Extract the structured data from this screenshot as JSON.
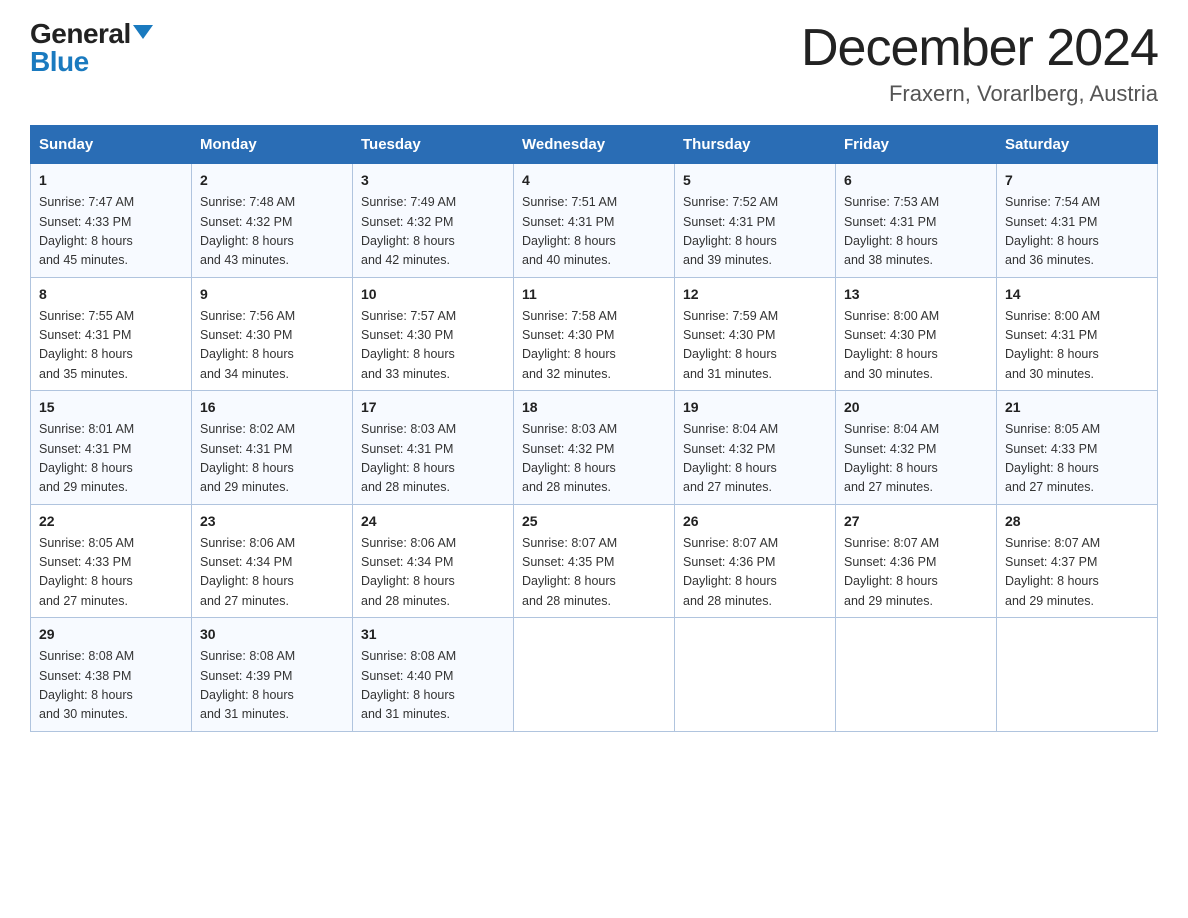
{
  "header": {
    "logo_general": "General",
    "logo_blue": "Blue",
    "month_title": "December 2024",
    "location": "Fraxern, Vorarlberg, Austria"
  },
  "days_of_week": [
    "Sunday",
    "Monday",
    "Tuesday",
    "Wednesday",
    "Thursday",
    "Friday",
    "Saturday"
  ],
  "weeks": [
    [
      {
        "day": "1",
        "sunrise": "7:47 AM",
        "sunset": "4:33 PM",
        "daylight": "8 hours and 45 minutes."
      },
      {
        "day": "2",
        "sunrise": "7:48 AM",
        "sunset": "4:32 PM",
        "daylight": "8 hours and 43 minutes."
      },
      {
        "day": "3",
        "sunrise": "7:49 AM",
        "sunset": "4:32 PM",
        "daylight": "8 hours and 42 minutes."
      },
      {
        "day": "4",
        "sunrise": "7:51 AM",
        "sunset": "4:31 PM",
        "daylight": "8 hours and 40 minutes."
      },
      {
        "day": "5",
        "sunrise": "7:52 AM",
        "sunset": "4:31 PM",
        "daylight": "8 hours and 39 minutes."
      },
      {
        "day": "6",
        "sunrise": "7:53 AM",
        "sunset": "4:31 PM",
        "daylight": "8 hours and 38 minutes."
      },
      {
        "day": "7",
        "sunrise": "7:54 AM",
        "sunset": "4:31 PM",
        "daylight": "8 hours and 36 minutes."
      }
    ],
    [
      {
        "day": "8",
        "sunrise": "7:55 AM",
        "sunset": "4:31 PM",
        "daylight": "8 hours and 35 minutes."
      },
      {
        "day": "9",
        "sunrise": "7:56 AM",
        "sunset": "4:30 PM",
        "daylight": "8 hours and 34 minutes."
      },
      {
        "day": "10",
        "sunrise": "7:57 AM",
        "sunset": "4:30 PM",
        "daylight": "8 hours and 33 minutes."
      },
      {
        "day": "11",
        "sunrise": "7:58 AM",
        "sunset": "4:30 PM",
        "daylight": "8 hours and 32 minutes."
      },
      {
        "day": "12",
        "sunrise": "7:59 AM",
        "sunset": "4:30 PM",
        "daylight": "8 hours and 31 minutes."
      },
      {
        "day": "13",
        "sunrise": "8:00 AM",
        "sunset": "4:30 PM",
        "daylight": "8 hours and 30 minutes."
      },
      {
        "day": "14",
        "sunrise": "8:00 AM",
        "sunset": "4:31 PM",
        "daylight": "8 hours and 30 minutes."
      }
    ],
    [
      {
        "day": "15",
        "sunrise": "8:01 AM",
        "sunset": "4:31 PM",
        "daylight": "8 hours and 29 minutes."
      },
      {
        "day": "16",
        "sunrise": "8:02 AM",
        "sunset": "4:31 PM",
        "daylight": "8 hours and 29 minutes."
      },
      {
        "day": "17",
        "sunrise": "8:03 AM",
        "sunset": "4:31 PM",
        "daylight": "8 hours and 28 minutes."
      },
      {
        "day": "18",
        "sunrise": "8:03 AM",
        "sunset": "4:32 PM",
        "daylight": "8 hours and 28 minutes."
      },
      {
        "day": "19",
        "sunrise": "8:04 AM",
        "sunset": "4:32 PM",
        "daylight": "8 hours and 27 minutes."
      },
      {
        "day": "20",
        "sunrise": "8:04 AM",
        "sunset": "4:32 PM",
        "daylight": "8 hours and 27 minutes."
      },
      {
        "day": "21",
        "sunrise": "8:05 AM",
        "sunset": "4:33 PM",
        "daylight": "8 hours and 27 minutes."
      }
    ],
    [
      {
        "day": "22",
        "sunrise": "8:05 AM",
        "sunset": "4:33 PM",
        "daylight": "8 hours and 27 minutes."
      },
      {
        "day": "23",
        "sunrise": "8:06 AM",
        "sunset": "4:34 PM",
        "daylight": "8 hours and 27 minutes."
      },
      {
        "day": "24",
        "sunrise": "8:06 AM",
        "sunset": "4:34 PM",
        "daylight": "8 hours and 28 minutes."
      },
      {
        "day": "25",
        "sunrise": "8:07 AM",
        "sunset": "4:35 PM",
        "daylight": "8 hours and 28 minutes."
      },
      {
        "day": "26",
        "sunrise": "8:07 AM",
        "sunset": "4:36 PM",
        "daylight": "8 hours and 28 minutes."
      },
      {
        "day": "27",
        "sunrise": "8:07 AM",
        "sunset": "4:36 PM",
        "daylight": "8 hours and 29 minutes."
      },
      {
        "day": "28",
        "sunrise": "8:07 AM",
        "sunset": "4:37 PM",
        "daylight": "8 hours and 29 minutes."
      }
    ],
    [
      {
        "day": "29",
        "sunrise": "8:08 AM",
        "sunset": "4:38 PM",
        "daylight": "8 hours and 30 minutes."
      },
      {
        "day": "30",
        "sunrise": "8:08 AM",
        "sunset": "4:39 PM",
        "daylight": "8 hours and 31 minutes."
      },
      {
        "day": "31",
        "sunrise": "8:08 AM",
        "sunset": "4:40 PM",
        "daylight": "8 hours and 31 minutes."
      },
      null,
      null,
      null,
      null
    ]
  ],
  "labels": {
    "sunrise": "Sunrise:",
    "sunset": "Sunset:",
    "daylight": "Daylight:"
  }
}
